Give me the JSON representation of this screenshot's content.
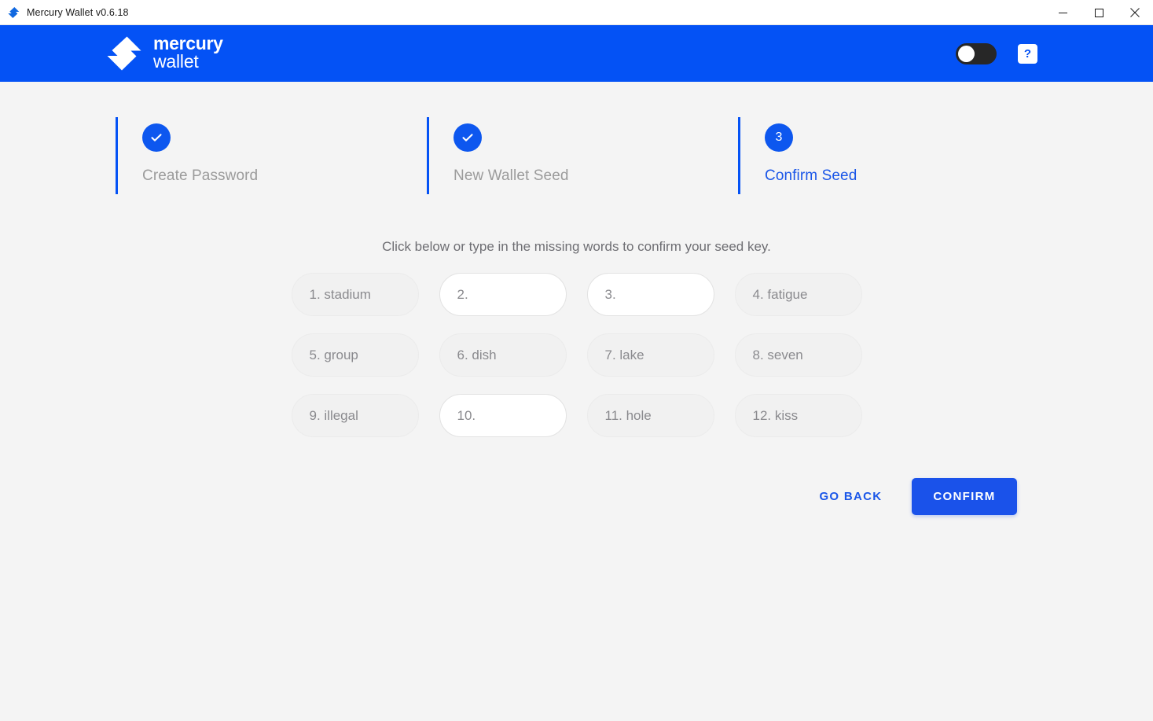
{
  "window": {
    "title": "Mercury Wallet v0.6.18",
    "app_icon": "mercury-logo-icon",
    "controls": {
      "minimize": "minimize-icon",
      "maximize": "maximize-icon",
      "close": "close-icon"
    }
  },
  "header": {
    "brand_line1": "mercury",
    "brand_line2": "wallet",
    "logo_icon": "mercury-logo-icon",
    "toggle": {
      "name": "theme-toggle",
      "state": "off"
    },
    "help_label": "?",
    "background_color": "#0452f5"
  },
  "stepper": {
    "steps": [
      {
        "label": "Create Password",
        "badge": "check",
        "state": "completed"
      },
      {
        "label": "New Wallet Seed",
        "badge": "check",
        "state": "completed"
      },
      {
        "label": "Confirm Seed",
        "badge": "3",
        "state": "active"
      }
    ],
    "accent_color": "#0452f5",
    "inactive_label_color": "#9b9b9b",
    "active_label_color": "#1a56e8"
  },
  "main": {
    "instructions": "Click below or type in the missing words to confirm your seed key.",
    "seed_words": [
      {
        "index": "1.",
        "word": "stadium",
        "filled": true
      },
      {
        "index": "2.",
        "word": "",
        "filled": false
      },
      {
        "index": "3.",
        "word": "",
        "filled": false
      },
      {
        "index": "4.",
        "word": "fatigue",
        "filled": true
      },
      {
        "index": "5.",
        "word": "group",
        "filled": true
      },
      {
        "index": "6.",
        "word": "dish",
        "filled": true
      },
      {
        "index": "7.",
        "word": "lake",
        "filled": true
      },
      {
        "index": "8.",
        "word": "seven",
        "filled": true
      },
      {
        "index": "9.",
        "word": "illegal",
        "filled": true
      },
      {
        "index": "10.",
        "word": "",
        "filled": false
      },
      {
        "index": "11.",
        "word": "hole",
        "filled": true
      },
      {
        "index": "12.",
        "word": "kiss",
        "filled": true
      }
    ]
  },
  "actions": {
    "go_back_label": "GO BACK",
    "confirm_label": "CONFIRM",
    "primary_color": "#1a52ea"
  }
}
